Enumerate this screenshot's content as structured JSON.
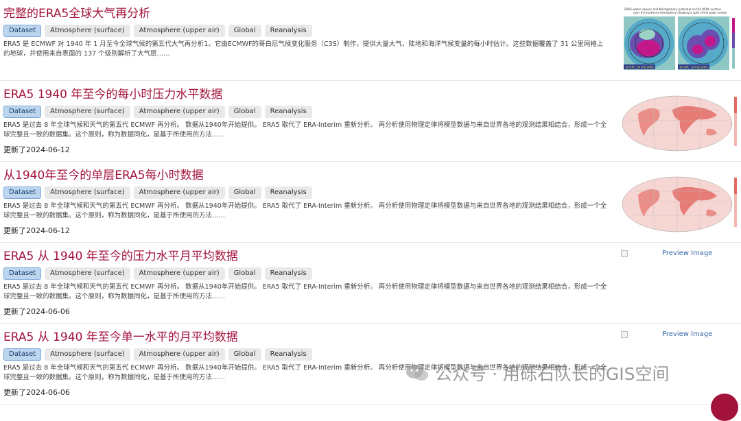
{
  "results": [
    {
      "title": "完整的ERA5全球大气再分析",
      "tags": [
        "Dataset",
        "Atmosphere (surface)",
        "Atmosphere (upper air)",
        "Global",
        "Reanalysis"
      ],
      "description": "ERA5 是 ECMWF 对 1940 年 1 月至今全球气候的第五代大气再分析1。它由ECMWF的哥白尼气候变化服务（C3S）制作，提供大量大气，陆地和海洋气候变量的每小时估计。这些数据覆盖了 31 公里网格上的地球，并使用来自表面的 137 个级别解析了大气层……",
      "updated": "",
      "thumbnail": "polar-vortex-maps"
    },
    {
      "title": "ERA5 1940 年至今的每小时压力水平数据",
      "tags": [
        "Dataset",
        "Atmosphere (surface)",
        "Atmosphere (upper air)",
        "Global",
        "Reanalysis"
      ],
      "description": "ERA5 是过去 8 年全球气候和天气的第五代 ECMWF 再分析。 数据从1940年开始提供。 ERA5 取代了 ERA-Interim 重新分析。 再分析使用物理定律将模型数据与来自世界各地的观测结果相结合，形成一个全球完整且一致的数据集。这个原则，称为数据同化，是基于所使用的方法……",
      "updated": "更新了2024-06-12",
      "thumbnail": "temperature-world-map"
    },
    {
      "title": "从1940年至今的单层ERA5每小时数据",
      "tags": [
        "Dataset",
        "Atmosphere (surface)",
        "Atmosphere (upper air)",
        "Global",
        "Reanalysis"
      ],
      "description": "ERA5 是过去 8 年全球气候和天气的第五代 ECMWF 再分析。 数据从1940年开始提供。 ERA5 取代了 ERA-Interim 重新分析。 再分析使用物理定律将模型数据与来自世界各地的观测结果相结合，形成一个全球完整且一致的数据集。这个原则，称为数据同化，是基于所使用的方法……",
      "updated": "更新了2024-06-12",
      "thumbnail": "temperature-world-map"
    },
    {
      "title": "ERA5 从 1940 年至今的压力水平月平均数据",
      "tags": [
        "Dataset",
        "Atmosphere (surface)",
        "Atmosphere (upper air)",
        "Global",
        "Reanalysis"
      ],
      "description": "ERA5 是过去 8 年全球气候和天气的第五代 ECMWF 再分析。 数据从1940年开始提供。 ERA5 取代了 ERA-Interim 重新分析。 再分析使用物理定律将模型数据与来自世界各地的观测结果相结合，形成一个全球完整且一致的数据集。这个原则，称为数据同化，是基于所使用的方法……",
      "updated": "更新了2024-06-06",
      "thumbnail": "",
      "preview_label": "Preview Image"
    },
    {
      "title": "ERA5 从 1940 年至今单一水平的月平均数据",
      "tags": [
        "Dataset",
        "Atmosphere (surface)",
        "Atmosphere (upper air)",
        "Global",
        "Reanalysis"
      ],
      "description": "ERA5 是过去 8 年全球气候和天气的第五代 ECMWF 再分析。 数据从1940年开始提供。 ERA5 取代了 ERA-Interim 重新分析。 再分析使用物理定律将模型数据与来自世界各地的观测结果相结合，形成一个全球完整且一致的数据集。这个原则，称为数据同化，是基于所使用的方法……",
      "updated": "更新了2024-06-06",
      "thumbnail": "",
      "preview_label": "Preview Image"
    }
  ],
  "watermark": "公众号 · 用砾石队长的GIS空间",
  "colors": {
    "title": "#a3123b",
    "tag_primary_bg": "#bcd5ef",
    "tag_bg": "#e9e9e9",
    "link": "#3567a8"
  }
}
